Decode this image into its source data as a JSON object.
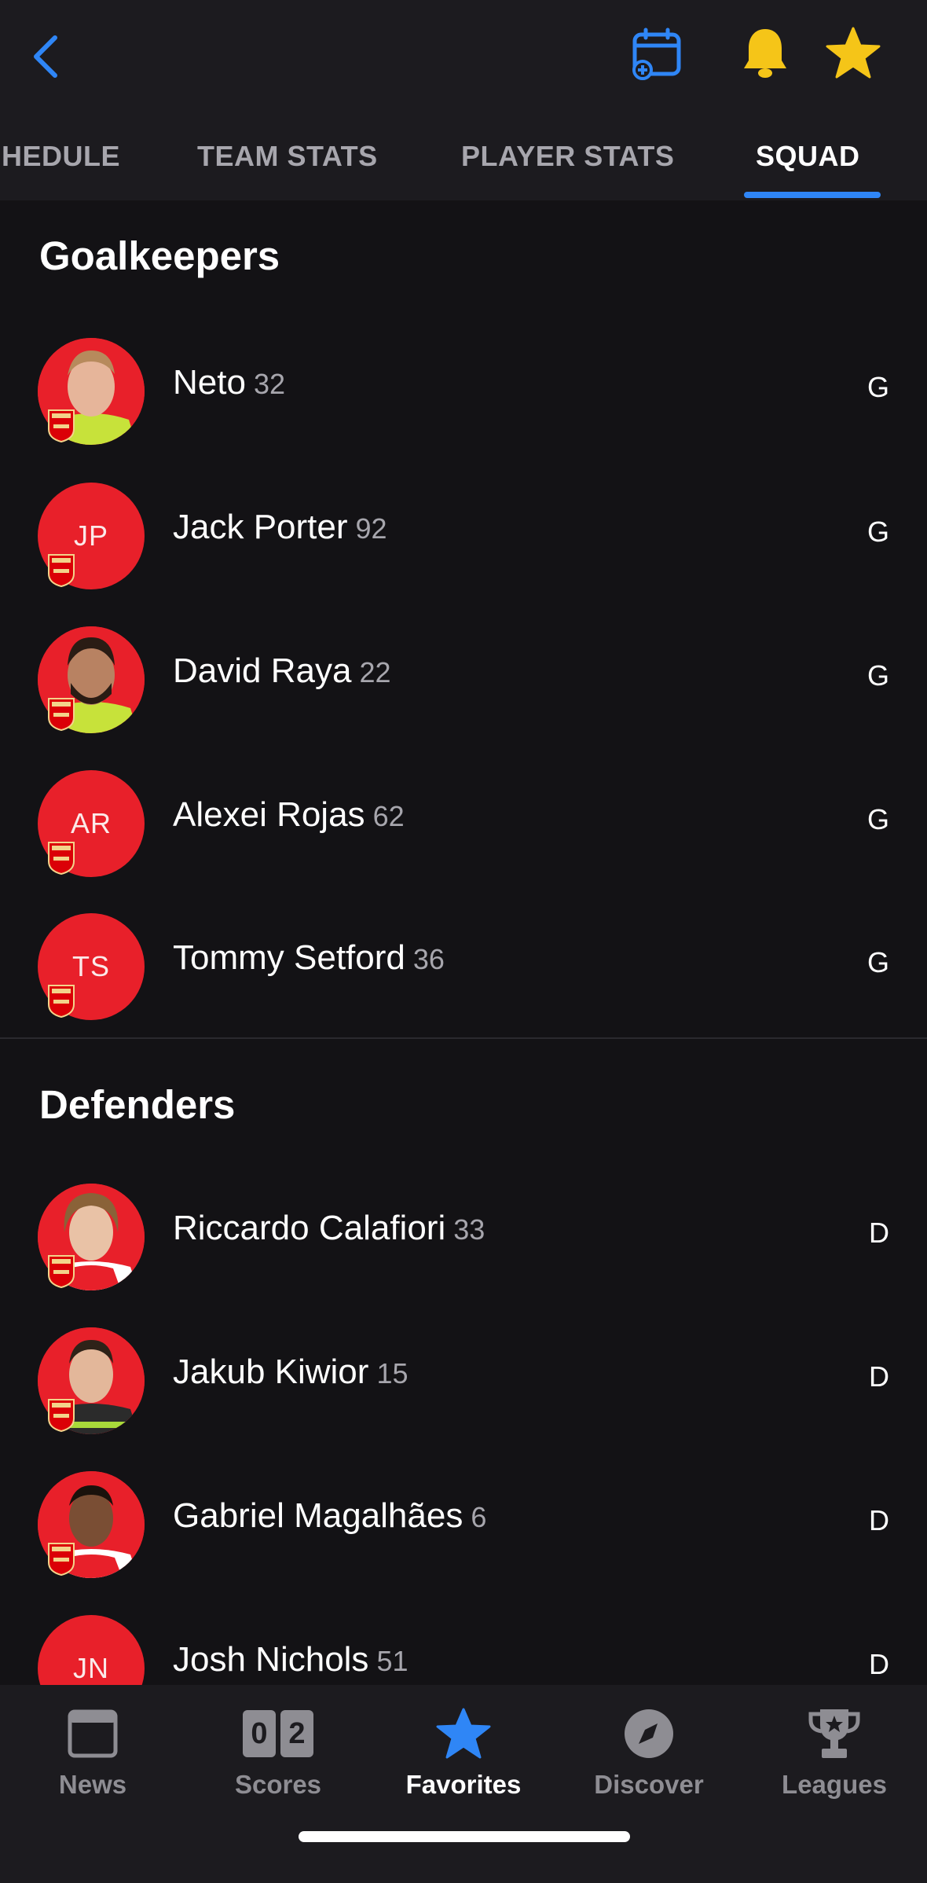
{
  "header": {
    "tabs": [
      {
        "label": "HEDULE"
      },
      {
        "label": "TEAM STATS"
      },
      {
        "label": "PLAYER STATS"
      },
      {
        "label": "SQUAD"
      }
    ],
    "active_tab": "SQUAD"
  },
  "sections": [
    {
      "title": "Goalkeepers",
      "players": [
        {
          "name": "Neto",
          "number": "32",
          "position": "G",
          "initials": "",
          "has_photo": true
        },
        {
          "name": "Jack Porter",
          "number": "92",
          "position": "G",
          "initials": "JP",
          "has_photo": false
        },
        {
          "name": "David Raya",
          "number": "22",
          "position": "G",
          "initials": "",
          "has_photo": true
        },
        {
          "name": "Alexei Rojas",
          "number": "62",
          "position": "G",
          "initials": "AR",
          "has_photo": false
        },
        {
          "name": "Tommy Setford",
          "number": "36",
          "position": "G",
          "initials": "TS",
          "has_photo": false
        }
      ]
    },
    {
      "title": "Defenders",
      "players": [
        {
          "name": "Riccardo Calafiori",
          "number": "33",
          "position": "D",
          "initials": "",
          "has_photo": true
        },
        {
          "name": "Jakub Kiwior",
          "number": "15",
          "position": "D",
          "initials": "",
          "has_photo": true
        },
        {
          "name": "Gabriel Magalhães",
          "number": "6",
          "position": "D",
          "initials": "",
          "has_photo": true
        },
        {
          "name": "Josh Nichols",
          "number": "51",
          "position": "D",
          "initials": "JN",
          "has_photo": false
        }
      ]
    }
  ],
  "bottom_nav": {
    "items": [
      {
        "label": "News",
        "icon": "news-icon"
      },
      {
        "label": "Scores",
        "icon": "scores-icon",
        "score_left": "0",
        "score_right": "2"
      },
      {
        "label": "Favorites",
        "icon": "star-icon"
      },
      {
        "label": "Discover",
        "icon": "compass-icon"
      },
      {
        "label": "Leagues",
        "icon": "trophy-icon"
      }
    ],
    "active": "Favorites"
  },
  "colors": {
    "accent": "#2f86f6",
    "gold": "#f5c518",
    "team_red": "#e8202a",
    "background": "#131215"
  }
}
